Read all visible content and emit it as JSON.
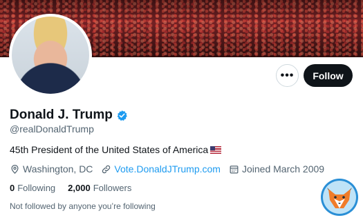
{
  "profile": {
    "display_name": "Donald J. Trump",
    "handle": "@realDonaldTrump",
    "bio": "45th President of the United States of America",
    "location": "Washington, DC",
    "website": "Vote.DonaldJTrump.com",
    "joined": "Joined March 2009",
    "following_count": "0",
    "following_label": "Following",
    "followers_count": "2,000",
    "followers_label": "Followers",
    "mutual_note": "Not followed by anyone you’re following"
  },
  "actions": {
    "more_label": "•••",
    "follow_label": "Follow"
  },
  "icons": {
    "verified": "verified-badge-icon",
    "location": "location-pin-icon",
    "link": "link-icon",
    "calendar": "calendar-icon",
    "flag": "us-flag-emoji",
    "watermark": "fox-logo-icon"
  },
  "colors": {
    "accent": "#1d9bf0",
    "text": "#0f1419",
    "secondary": "#536471",
    "button": "#0f1419"
  }
}
